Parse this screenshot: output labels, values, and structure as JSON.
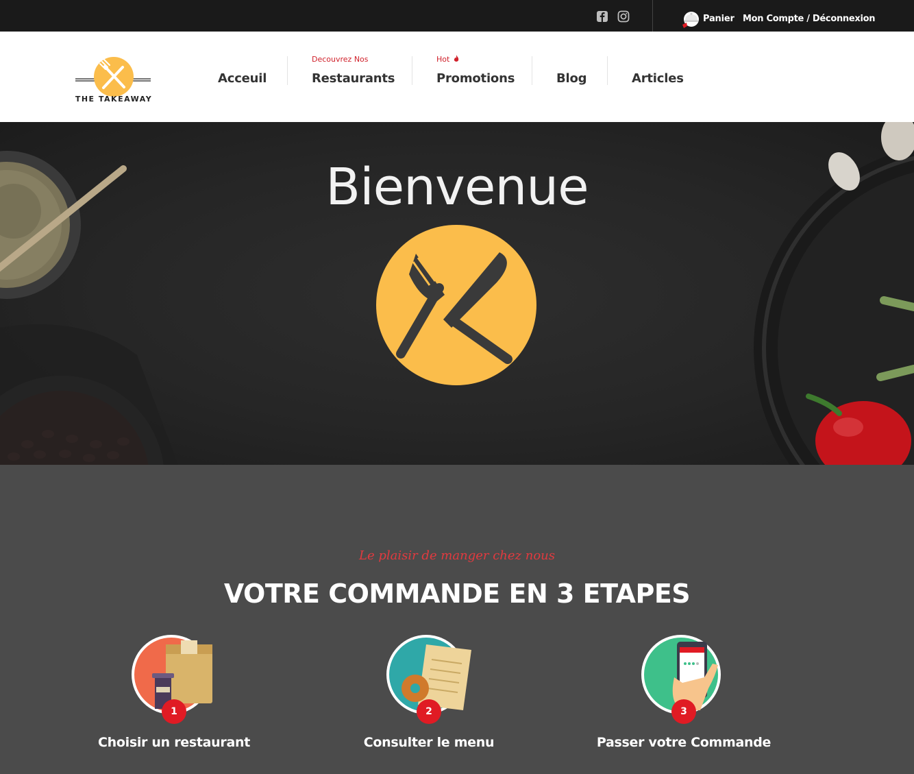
{
  "topbar": {
    "social": [
      {
        "icon": "facebook-icon"
      },
      {
        "icon": "instagram-icon"
      }
    ],
    "cart_label": "Panier",
    "account_label": "Mon Compte / Déconnexion"
  },
  "logo": {
    "text": "THE TAKEAWAY",
    "color": "#fbbd4b"
  },
  "nav": {
    "items": [
      {
        "label": "Acceuil",
        "sub": ""
      },
      {
        "label": "Restaurants",
        "sub": "Decouvrez Nos"
      },
      {
        "label": "Promotions",
        "sub": "Hot"
      },
      {
        "label": "Blog",
        "sub": ""
      },
      {
        "label": "Articles",
        "sub": ""
      }
    ],
    "accent": "#d0212b"
  },
  "hero": {
    "title": "Bienvenue",
    "badge_color": "#fbbd4b"
  },
  "steps": {
    "tagline": "Le plaisir de manger chez nous",
    "title": "VOTRE COMMANDE EN 3 ETAPES",
    "items": [
      {
        "number": "1",
        "label": "Choisir un restaurant",
        "icon": "takeaway-bag-icon"
      },
      {
        "number": "2",
        "label": "Consulter le menu",
        "icon": "menu-paper-icon"
      },
      {
        "number": "3",
        "label": "Passer votre Commande",
        "icon": "phone-order-icon"
      }
    ],
    "badge_color": "#e01b24"
  }
}
